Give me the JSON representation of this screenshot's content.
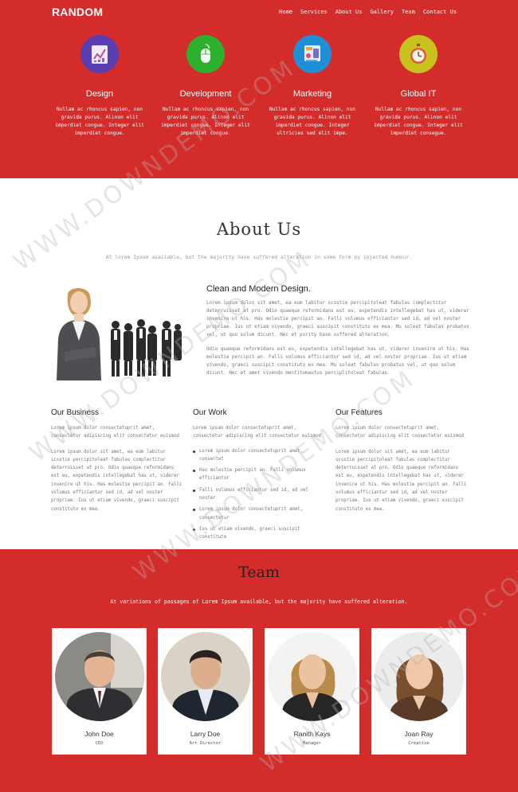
{
  "header": {
    "logo": "RANDOM",
    "nav": [
      "Home",
      "Services",
      "About Us",
      "Gallery",
      "Team",
      "Contact Us"
    ]
  },
  "services": [
    {
      "title": "Design",
      "text": "Nullam ac rhoncus sapien, non gravida purus. Alinon elit imperdiet congue. Integer elit imperdiet congue.",
      "icon": "design-chart-icon",
      "color": "#5a3fb2"
    },
    {
      "title": "Development",
      "text": "Nullam ac rhoncus sapien, non gravida purus. Alinon elit imperdiet congue. Integer elit imperdiet congue.",
      "icon": "mouse-icon",
      "color": "#2db02d"
    },
    {
      "title": "Marketing",
      "text": "Nullam ac rhoncus sapien, non gravida purus. Alinon elit imperdiet congue. Integer ultricies sed elit impe.",
      "icon": "mobile-marketing-icon",
      "color": "#1e8fd6"
    },
    {
      "title": "Global IT",
      "text": "Nullam ac rhoncus sapien, non gravida purus. Alinon elit imperdiet congue. Integer elit imperdiet consegue.",
      "icon": "stopwatch-icon",
      "color": "#c8c21e"
    }
  ],
  "about": {
    "title": "About Us",
    "subtitle": "At lorem Ipsum available, but the majority have suffered alteration in some form by injected humour.",
    "clean_title": "Clean and Modern Design.",
    "clean_p1": "Lorem ipsum dolor sit amet, ea eum labitur scsstie percipitoleat fabulas complectitur deterruisset at pro. Odio quaeque reformidans est eu, expetendis intellegebat has ut, viderer invenire ut his. Has molestie percipit an. Falli volumus efficiantur sed id, ad vel noster propriae. Ius ut etiam vivendo, graeci suscipit constituto ex mea. Mu soleat fabulas probatus vel, ut quo solum dicunt. Nec et purity base suffered alteration.",
    "clean_p2": "Odio quaeque reformidans est eu, expetendis intellegebat has ut, viderer invenire ut his. Has molestie percipit an. Falli volumus efficiantur sed id, ad vel noster propriae. Ius ut etiam vivendo, graeci suscipit constituto ex mea. Mu soleat fabulas probatus vel, ut quo solum dicunt. Nec et amet vivendo mentitumautus perciplitoleat fabulas."
  },
  "columns": {
    "business": {
      "title": "Our Business",
      "p1": "Lorem ipsum dolor consectetuprit amet, consectetur adipiscing elit consectetur euismod",
      "p2": "Lorem ipsum dolor sit amet, ea eum labitur scsstie percipitoleat fabulas complectitur deterruisset at pro. Odio quaeque reformidans est eu, expetendis intellegebat has ut, viderer invenire ut his. Has molestie percipit an. Falli volumus efficiantur sed id, ad vel noster propriae. Ius ut etiam vivendo, graeci suscipit constituto ex mea."
    },
    "work": {
      "title": "Our Work",
      "p1": "Lorem ipsum dolor consectetuprit amet, consectetur adipiscing elit consectetur euismod",
      "items": [
        "Lorem ipsum dolor consectetuprit amet, consectet",
        "Has molestie percipit an. Falli volumus efficiantur",
        "Falli volumus efficiantur sed id, ad vel noster",
        "Lorem ipsum dolor consectetuprit amet, consectetur",
        "Ius ut etiam vivendo, graeci suscipit constitute"
      ]
    },
    "features": {
      "title": "Our Features",
      "p1": "Lorem ipsum dolor consectetuprit amet, consectetur adipiscing elit consectetur euismod",
      "p2": "Lorem ipsum dolor sit amet, ea eum labitur scsstie percipitoleat fabulas complectitur deterruisset at pro. Odio quaeque reformidans est eu, expetendis intellegebat has ut, viderer invenire ut his. Has molestie percipit an. Falli volumus efficiantur sed id, ad vel noster propriae. Ius ut etiam vivendo, graeci suscipit constituto ex mea."
    }
  },
  "team": {
    "title": "Team",
    "subtitle": "At variations of passages of Lorem Ipsum available, but the majority have suffered alteration.",
    "members": [
      {
        "name": "John Doe",
        "role": "CEO"
      },
      {
        "name": "Larry Doe",
        "role": "Art Director"
      },
      {
        "name": "Ranith Kays",
        "role": "Manager"
      },
      {
        "name": "Joan Ray",
        "role": "Creative"
      }
    ]
  },
  "watermark": "WWW.DOWNDEMO.COM"
}
